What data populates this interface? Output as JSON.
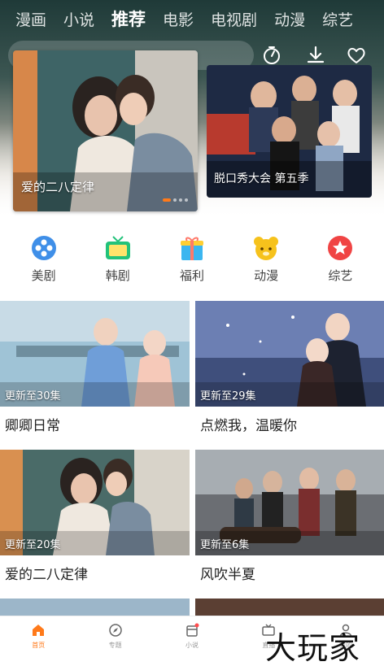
{
  "top_tabs": [
    {
      "label": "漫画",
      "active": false
    },
    {
      "label": "小说",
      "active": false
    },
    {
      "label": "推荐",
      "active": true
    },
    {
      "label": "电影",
      "active": false
    },
    {
      "label": "电视剧",
      "active": false
    },
    {
      "label": "动漫",
      "active": false
    },
    {
      "label": "综艺",
      "active": false
    }
  ],
  "top_icons": [
    "timer-icon",
    "download-icon",
    "favorite-icon"
  ],
  "hero": {
    "main": {
      "caption": "爱的二八定律",
      "indicator_count": 4,
      "active_index": 0
    },
    "side": {
      "caption": "脱口秀大会 第五季"
    }
  },
  "categories": [
    {
      "label": "美剧",
      "icon": "film-reel-icon",
      "color": "#3f8fe8"
    },
    {
      "label": "韩剧",
      "icon": "tv-icon",
      "color": "#22c27a"
    },
    {
      "label": "福利",
      "icon": "gift-box-icon",
      "color": "#3bb6f0"
    },
    {
      "label": "动漫",
      "icon": "bear-icon",
      "color": "#f6c21c"
    },
    {
      "label": "综艺",
      "icon": "star-icon",
      "color": "#f04444"
    }
  ],
  "grid": [
    {
      "title": "卿卿日常",
      "update": "更新至30集"
    },
    {
      "title": "点燃我，温暖你",
      "update": "更新至29集"
    },
    {
      "title": "爱的二八定律",
      "update": "更新至20集"
    },
    {
      "title": "风吹半夏",
      "update": "更新至6集"
    }
  ],
  "bottom_nav": [
    {
      "label": "首页",
      "icon": "home-icon",
      "active": true
    },
    {
      "label": "专题",
      "icon": "compass-icon",
      "active": false
    },
    {
      "label": "小说",
      "icon": "book-icon",
      "active": false
    },
    {
      "label": "直播",
      "icon": "live-icon",
      "active": false
    },
    {
      "label": "我的",
      "icon": "user-icon",
      "active": false
    }
  ],
  "watermark": "大玩家",
  "colors": {
    "accent": "#ff7a1a"
  }
}
